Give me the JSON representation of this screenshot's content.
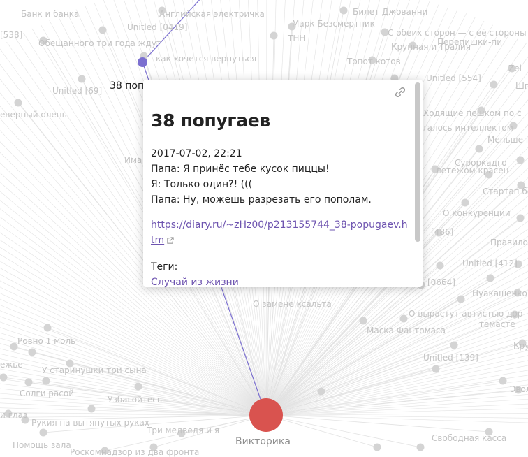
{
  "graph": {
    "active_node": "38 попугаев",
    "hub_node": "Викторика",
    "colors": {
      "active_node": "#7b6fd0",
      "hub_node": "#d9534f",
      "node": "#d4d4d4",
      "edge": "#e2e2e2",
      "highlight_edge": "#7b6fd0"
    },
    "labels": [
      "Банк и банка",
      "Английская электричка",
      "Билет Джованни",
      "[538]",
      "Unitled [0419]",
      "Марк Безсмертник",
      "С обеих сторон — с её стороны",
      "Обещанного три года ждут",
      "ТНН",
      "Перепишки-пи",
      "как хочется вернуться",
      "Крупная и Тралия",
      "Zel",
      "Топот котов",
      "Шпилк",
      "Unitled [69]",
      "Unitled [554]",
      "Ходящие пешком по с",
      "еверный олень",
      "сталось интеллектом",
      "Меньше на",
      "Има",
      "Суроркадго",
      "Стартап бе",
      "летежом красен",
      "О конкуренции",
      "[486]",
      "Unitled [412]",
      "Правило т",
      "[0664]",
      "Нуакашенко",
      "О замене ксальта",
      "О вырастут автистью дор",
      "темасте",
      "Маска Фантомаса",
      "Крупи",
      "Ровно 1 моль",
      "Unitled [139]",
      "ежье",
      "У старинушки три сына",
      "Солги расой",
      "Узбагойтесь",
      "Эвол",
      "Рукия на вытянутых руках",
      "Три медведя и я",
      "и глаз",
      "Помощь зала",
      "Роскомнадзор из два фронта",
      "Свободная касса"
    ]
  },
  "popup": {
    "title": "38 попугаев",
    "date": "2017-07-02, 22:21",
    "lines": [
      "Папа: Я принёс тебе кусок пиццы!",
      "Я: Только один?! (((",
      "Папа: Ну, можешь разрезать его пополам."
    ],
    "link": "https://diary.ru/~zHz00/p213155744_38-popugaev.htm",
    "tags_label": "Теги:",
    "tags": [
      "Случай из жизни"
    ]
  }
}
